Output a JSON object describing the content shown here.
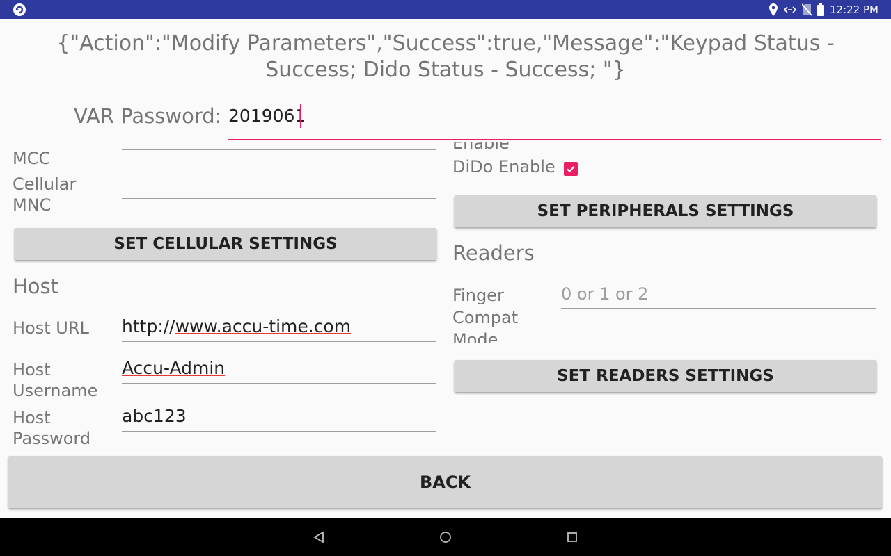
{
  "status_bar": {
    "time": "12:22 PM",
    "icons": [
      "app-icon",
      "location-icon",
      "data-icon",
      "no-sim-icon",
      "battery-icon"
    ]
  },
  "message": "{\"Action\":\"Modify Parameters\",\"Success\":true,\"Message\":\"Keypad Status - Success; Dido Status - Success; \"}",
  "var_password": {
    "label": "VAR Password:",
    "value": "2019061"
  },
  "cellular": {
    "mcc_label": "MCC",
    "mnc_label": "Cellular\nMNC",
    "button": "SET CELLULAR SETTINGS"
  },
  "host": {
    "title": "Host",
    "url_label": "Host URL",
    "url_value": "http://www.accu-time.com",
    "url_prefix": "http://",
    "url_rest": "www.accu-time.com",
    "username_label": "Host\nUsername",
    "username_value": "Accu-Admin",
    "password_label": "Host\nPassword",
    "password_value": "abc123"
  },
  "peripherals": {
    "partial_label": "Enable",
    "dido_label": "DiDo Enable",
    "dido_checked": true,
    "button": "SET PERIPHERALS SETTINGS"
  },
  "readers": {
    "title": "Readers",
    "finger_label": "Finger\nCompat\nMode",
    "finger_placeholder": "0 or 1 or 2",
    "button": "SET READERS SETTINGS"
  },
  "back_button": "BACK",
  "colors": {
    "status_bar": "#2f3a9f",
    "accent": "#e91e63",
    "button_bg": "#d6d6d6"
  }
}
